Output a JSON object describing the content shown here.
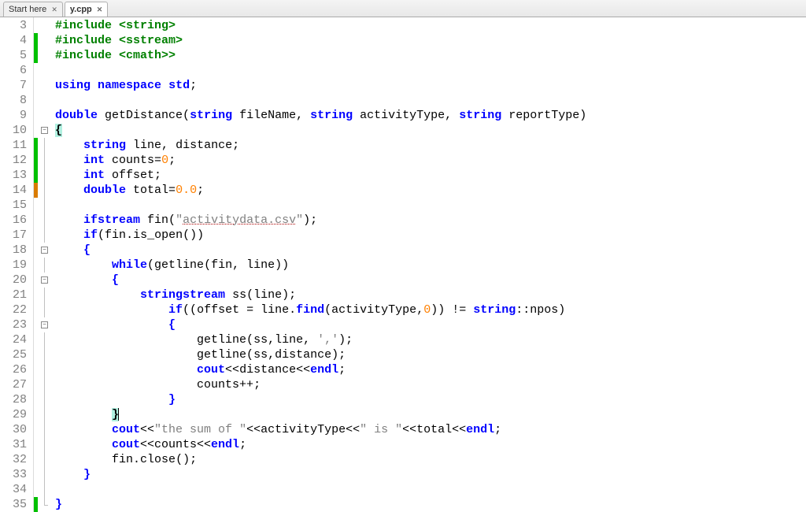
{
  "tabs": [
    {
      "label": "Start here",
      "active": false
    },
    {
      "label": "y.cpp",
      "active": true
    }
  ],
  "first_line_number": 3,
  "line_count": 33,
  "change_marks": {
    "4": "green",
    "5": "green",
    "11": "green",
    "12": "green",
    "13": "green",
    "14": "orange",
    "35": "green"
  },
  "fold": {
    "10": "box-minus",
    "11": "line",
    "12": "line",
    "13": "line",
    "14": "line",
    "15": "line",
    "16": "line",
    "17": "line",
    "18": "box-minus",
    "19": "line",
    "20": "box-minus",
    "21": "line",
    "22": "line",
    "23": "box-minus",
    "24": "line",
    "25": "line",
    "26": "line",
    "27": "line",
    "28": "line",
    "29": "line",
    "30": "line",
    "31": "line",
    "32": "line",
    "33": "line",
    "34": "line",
    "35": "corner"
  },
  "code": {
    "3": [
      {
        "t": "#include <string>",
        "c": "pre"
      }
    ],
    "4": [
      {
        "t": "#include <sstream>",
        "c": "pre"
      }
    ],
    "5": [
      {
        "t": "#include <cmath>>",
        "c": "pre"
      }
    ],
    "6": [],
    "7": [
      {
        "t": "using",
        "c": "kw"
      },
      {
        "t": " "
      },
      {
        "t": "namespace",
        "c": "kw"
      },
      {
        "t": " "
      },
      {
        "t": "std",
        "c": "kw"
      },
      {
        "t": ";"
      }
    ],
    "8": [],
    "9": [
      {
        "t": "double",
        "c": "kw"
      },
      {
        "t": " getDistance"
      },
      {
        "t": "("
      },
      {
        "t": "string",
        "c": "kw"
      },
      {
        "t": " fileName"
      },
      {
        "t": ","
      },
      {
        "t": " "
      },
      {
        "t": "string",
        "c": "kw"
      },
      {
        "t": " activityType"
      },
      {
        "t": ","
      },
      {
        "t": " "
      },
      {
        "t": "string",
        "c": "kw"
      },
      {
        "t": " reportType"
      },
      {
        "t": ")"
      }
    ],
    "10": [
      {
        "t": "{",
        "c": "teal"
      }
    ],
    "11": [
      {
        "t": "    "
      },
      {
        "t": "string",
        "c": "kw"
      },
      {
        "t": " line"
      },
      {
        "t": ","
      },
      {
        "t": " distance"
      },
      {
        "t": ";"
      }
    ],
    "12": [
      {
        "t": "    "
      },
      {
        "t": "int",
        "c": "kw"
      },
      {
        "t": " counts"
      },
      {
        "t": "="
      },
      {
        "t": "0",
        "c": "num"
      },
      {
        "t": ";"
      }
    ],
    "13": [
      {
        "t": "    "
      },
      {
        "t": "int",
        "c": "kw"
      },
      {
        "t": " offset"
      },
      {
        "t": ";"
      }
    ],
    "14": [
      {
        "t": "    "
      },
      {
        "t": "double",
        "c": "kw"
      },
      {
        "t": " total"
      },
      {
        "t": "="
      },
      {
        "t": "0.0",
        "c": "num"
      },
      {
        "t": ";"
      }
    ],
    "15": [],
    "16": [
      {
        "t": "    "
      },
      {
        "t": "ifstream",
        "c": "kw"
      },
      {
        "t": " fin"
      },
      {
        "t": "("
      },
      {
        "t": "\"",
        "c": "str"
      },
      {
        "t": "activitydata.csv",
        "c": "strlit"
      },
      {
        "t": "\"",
        "c": "str"
      },
      {
        "t": ")"
      },
      {
        "t": ";"
      }
    ],
    "17": [
      {
        "t": "    "
      },
      {
        "t": "if",
        "c": "kw"
      },
      {
        "t": "("
      },
      {
        "t": "fin"
      },
      {
        "t": "."
      },
      {
        "t": "is_open"
      },
      {
        "t": "()"
      },
      {
        "t": ")"
      }
    ],
    "18": [
      {
        "t": "    "
      },
      {
        "t": "{",
        "c": "kw"
      }
    ],
    "19": [
      {
        "t": "        "
      },
      {
        "t": "while",
        "c": "kw"
      },
      {
        "t": "("
      },
      {
        "t": "getline"
      },
      {
        "t": "("
      },
      {
        "t": "fin"
      },
      {
        "t": ","
      },
      {
        "t": " line"
      },
      {
        "t": ")"
      },
      {
        "t": ")"
      }
    ],
    "20": [
      {
        "t": "        "
      },
      {
        "t": "{",
        "c": "kw"
      }
    ],
    "21": [
      {
        "t": "            "
      },
      {
        "t": "stringstream",
        "c": "kw"
      },
      {
        "t": " ss"
      },
      {
        "t": "("
      },
      {
        "t": "line"
      },
      {
        "t": ")"
      },
      {
        "t": ";"
      }
    ],
    "22": [
      {
        "t": "                "
      },
      {
        "t": "if",
        "c": "kw"
      },
      {
        "t": "(("
      },
      {
        "t": "offset"
      },
      {
        "t": " = "
      },
      {
        "t": "line"
      },
      {
        "t": "."
      },
      {
        "t": "find",
        "c": "kw"
      },
      {
        "t": "("
      },
      {
        "t": "activityType"
      },
      {
        "t": ","
      },
      {
        "t": "0",
        "c": "num"
      },
      {
        "t": ")"
      },
      {
        "t": ")"
      },
      {
        "t": " != "
      },
      {
        "t": "string",
        "c": "kw"
      },
      {
        "t": "::npos"
      },
      {
        "t": ")"
      }
    ],
    "23": [
      {
        "t": "                "
      },
      {
        "t": "{",
        "c": "kw"
      }
    ],
    "24": [
      {
        "t": "                    getline"
      },
      {
        "t": "("
      },
      {
        "t": "ss"
      },
      {
        "t": ","
      },
      {
        "t": "line"
      },
      {
        "t": ","
      },
      {
        "t": " "
      },
      {
        "t": "','",
        "c": "str"
      },
      {
        "t": ")"
      },
      {
        "t": ";"
      }
    ],
    "25": [
      {
        "t": "                    getline"
      },
      {
        "t": "("
      },
      {
        "t": "ss"
      },
      {
        "t": ","
      },
      {
        "t": "distance"
      },
      {
        "t": ")"
      },
      {
        "t": ";"
      }
    ],
    "26": [
      {
        "t": "                    "
      },
      {
        "t": "cout",
        "c": "kw"
      },
      {
        "t": "<<"
      },
      {
        "t": "distance"
      },
      {
        "t": "<<"
      },
      {
        "t": "endl",
        "c": "kw"
      },
      {
        "t": ";"
      }
    ],
    "27": [
      {
        "t": "                    counts"
      },
      {
        "t": "++"
      },
      {
        "t": ";"
      }
    ],
    "28": [
      {
        "t": "                "
      },
      {
        "t": "}",
        "c": "kw"
      }
    ],
    "29": [
      {
        "t": "        "
      },
      {
        "t": "}",
        "c": "teal"
      },
      {
        "t": "",
        "cursor": true
      }
    ],
    "30": [
      {
        "t": "        "
      },
      {
        "t": "cout",
        "c": "kw"
      },
      {
        "t": "<<"
      },
      {
        "t": "\"the sum of \"",
        "c": "str"
      },
      {
        "t": "<<activityType<<"
      },
      {
        "t": "\" is \"",
        "c": "str"
      },
      {
        "t": "<<total<<"
      },
      {
        "t": "endl",
        "c": "kw"
      },
      {
        "t": ";"
      }
    ],
    "31": [
      {
        "t": "        "
      },
      {
        "t": "cout",
        "c": "kw"
      },
      {
        "t": "<<counts<<"
      },
      {
        "t": "endl",
        "c": "kw"
      },
      {
        "t": ";"
      }
    ],
    "32": [
      {
        "t": "        fin"
      },
      {
        "t": "."
      },
      {
        "t": "close"
      },
      {
        "t": "()"
      },
      {
        "t": ";"
      }
    ],
    "33": [
      {
        "t": "    "
      },
      {
        "t": "}",
        "c": "kw"
      }
    ],
    "34": [],
    "35": [
      {
        "t": "}",
        "c": "kw"
      }
    ]
  }
}
